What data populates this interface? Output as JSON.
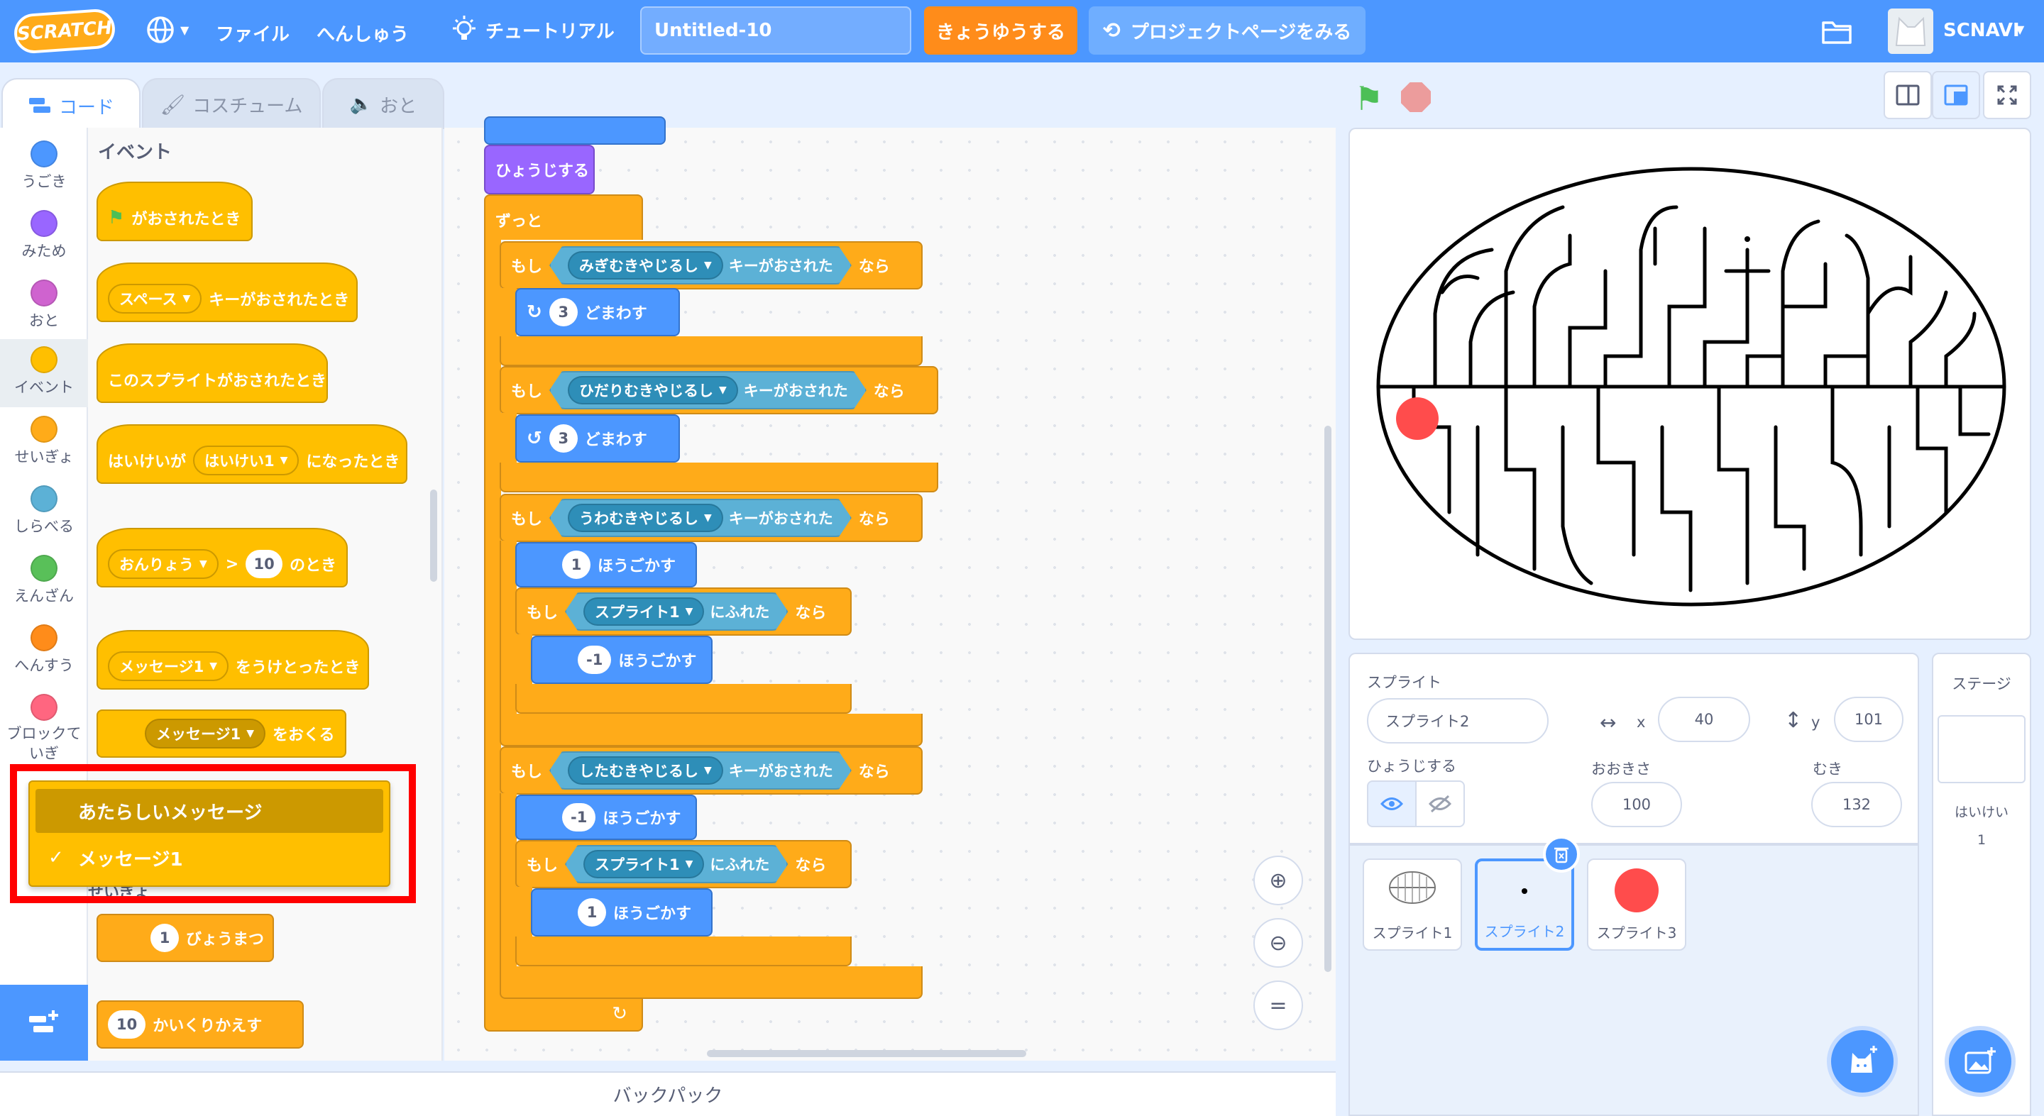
{
  "menubar": {
    "logo": "SCRATCH",
    "file": "ファイル",
    "edit": "へんしゅう",
    "tutorial": "チュートリアル",
    "project_title": "Untitled-10",
    "share": "きょうゆうする",
    "see_project": "プロジェクトページをみる",
    "username": "SCNAVI"
  },
  "tabs": {
    "code": "コード",
    "costume": "コスチューム",
    "sound": "おと"
  },
  "categories": [
    {
      "label": "うごき",
      "color": "#4c97ff"
    },
    {
      "label": "みため",
      "color": "#9966ff"
    },
    {
      "label": "おと",
      "color": "#cf63cf"
    },
    {
      "label": "イベント",
      "color": "#ffbf00"
    },
    {
      "label": "せいぎょ",
      "color": "#ffab19"
    },
    {
      "label": "しらべる",
      "color": "#5cb1d6"
    },
    {
      "label": "えんざん",
      "color": "#59c059"
    },
    {
      "label": "へんすう",
      "color": "#ff8c1a"
    },
    {
      "label": "ブロックていぎ",
      "color": "#ff6680"
    }
  ],
  "palette": {
    "heading": "イベント",
    "flag_clicked": "がおされたとき",
    "key_dd": "スペース",
    "key_pressed": "キーがおされたとき",
    "sprite_clicked": "このスプライトがおされたとき",
    "backdrop_prefix": "はいけいが",
    "backdrop_dd": "はいけい1",
    "backdrop_suffix": "になったとき",
    "loudness_dd": "おんりょう",
    "gt": ">",
    "loudness_val": "10",
    "loudness_suffix": "のとき",
    "msg_dd": "メッセージ1",
    "msg_received": "をうけとったとき",
    "broadcast_dd": "メッセージ1",
    "broadcast": "をおくる",
    "partial_heading": "せいぎょ",
    "wait_val": "1",
    "wait": "びょうまつ",
    "repeat_val": "10",
    "repeat": "かいくりかえす"
  },
  "dropdown": {
    "new_message": "あたらしいメッセージ",
    "check": "✓",
    "message1": "メッセージ1"
  },
  "script": {
    "show": "ひょうじする",
    "forever": "ずっと",
    "if": "もし",
    "then": "なら",
    "key_pressed": "キーがおされた",
    "right_arrow": "みぎむきやじるし",
    "left_arrow": "ひだりむきやじるし",
    "up_arrow": "うわむきやじるし",
    "down_arrow": "したむきやじるし",
    "turn": "どまわす",
    "turn_val": "3",
    "move": "ほうごかす",
    "one": "1",
    "minus_one": "-1",
    "touching_dd": "スプライト1",
    "touching": "にふれた",
    "loop_arrow": "↻"
  },
  "backpack": "バックパック",
  "sprite_info": {
    "sprite_label": "スプライト",
    "sprite_name": "スプライト2",
    "x_label": "x",
    "x_val": "40",
    "y_label": "y",
    "y_val": "101",
    "show_label": "ひょうじする",
    "size_label": "おおきさ",
    "size_val": "100",
    "dir_label": "むき",
    "dir_val": "132"
  },
  "sprites": [
    {
      "name": "スプライト1"
    },
    {
      "name": "スプライト2"
    },
    {
      "name": "スプライト3"
    }
  ],
  "stage_panel": {
    "title": "ステージ",
    "backdrops_label": "はいけい",
    "backdrops_count": "1"
  }
}
